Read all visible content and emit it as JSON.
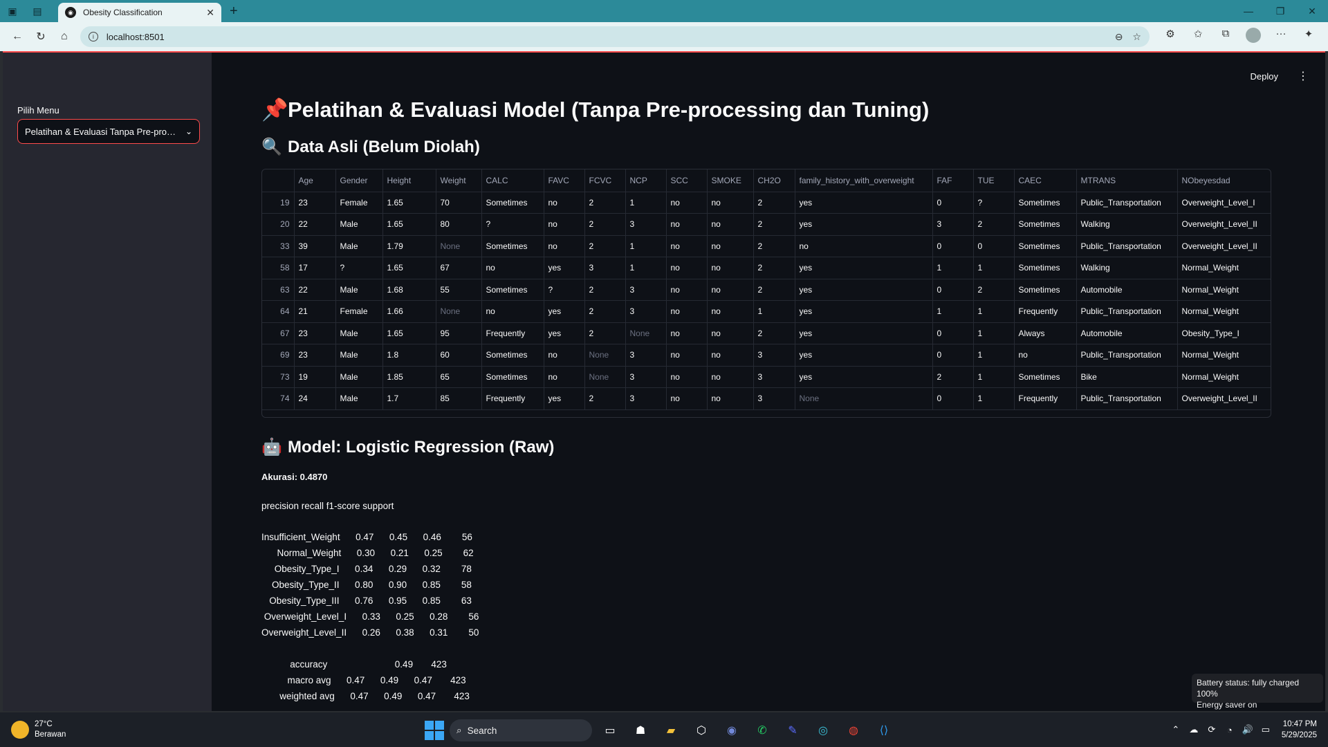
{
  "browser": {
    "tab_title": "Obesity Classification",
    "url": "localhost:8501"
  },
  "app": {
    "deploy_label": "Deploy",
    "sidebar": {
      "label": "Pilih Menu",
      "selected": "Pelatihan & Evaluasi Tanpa Pre-processing"
    },
    "title": "Pelatihan & Evaluasi Model (Tanpa Pre-processing dan Tuning)",
    "title_emoji": "📌",
    "section1": {
      "emoji": "🔍",
      "title": "Data Asli (Belum Diolah)"
    },
    "table": {
      "columns": [
        "",
        "Age",
        "Gender",
        "Height",
        "Weight",
        "CALC",
        "FAVC",
        "FCVC",
        "NCP",
        "SCC",
        "SMOKE",
        "CH2O",
        "family_history_with_overweight",
        "FAF",
        "TUE",
        "CAEC",
        "MTRANS",
        "NObeyesdad"
      ],
      "rows": [
        [
          "19",
          "23",
          "Female",
          "1.65",
          "70",
          "Sometimes",
          "no",
          "2",
          "1",
          "no",
          "no",
          "2",
          "yes",
          "0",
          "?",
          "Sometimes",
          "Public_Transportation",
          "Overweight_Level_I"
        ],
        [
          "20",
          "22",
          "Male",
          "1.65",
          "80",
          "?",
          "no",
          "2",
          "3",
          "no",
          "no",
          "2",
          "yes",
          "3",
          "2",
          "Sometimes",
          "Walking",
          "Overweight_Level_II"
        ],
        [
          "33",
          "39",
          "Male",
          "1.79",
          "None",
          "Sometimes",
          "no",
          "2",
          "1",
          "no",
          "no",
          "2",
          "no",
          "0",
          "0",
          "Sometimes",
          "Public_Transportation",
          "Overweight_Level_II"
        ],
        [
          "58",
          "17",
          "?",
          "1.65",
          "67",
          "no",
          "yes",
          "3",
          "1",
          "no",
          "no",
          "2",
          "yes",
          "1",
          "1",
          "Sometimes",
          "Walking",
          "Normal_Weight"
        ],
        [
          "63",
          "22",
          "Male",
          "1.68",
          "55",
          "Sometimes",
          "?",
          "2",
          "3",
          "no",
          "no",
          "2",
          "yes",
          "0",
          "2",
          "Sometimes",
          "Automobile",
          "Normal_Weight"
        ],
        [
          "64",
          "21",
          "Female",
          "1.66",
          "None",
          "no",
          "yes",
          "2",
          "3",
          "no",
          "no",
          "1",
          "yes",
          "1",
          "1",
          "Frequently",
          "Public_Transportation",
          "Normal_Weight"
        ],
        [
          "67",
          "23",
          "Male",
          "1.65",
          "95",
          "Frequently",
          "yes",
          "2",
          "None",
          "no",
          "no",
          "2",
          "yes",
          "0",
          "1",
          "Always",
          "Automobile",
          "Obesity_Type_I"
        ],
        [
          "69",
          "23",
          "Male",
          "1.8",
          "60",
          "Sometimes",
          "no",
          "None",
          "3",
          "no",
          "no",
          "3",
          "yes",
          "0",
          "1",
          "no",
          "Public_Transportation",
          "Normal_Weight"
        ],
        [
          "73",
          "19",
          "Male",
          "1.85",
          "65",
          "Sometimes",
          "no",
          "None",
          "3",
          "no",
          "no",
          "3",
          "yes",
          "2",
          "1",
          "Sometimes",
          "Bike",
          "Normal_Weight"
        ],
        [
          "74",
          "24",
          "Male",
          "1.7",
          "85",
          "Frequently",
          "yes",
          "2",
          "3",
          "no",
          "no",
          "3",
          "None",
          "0",
          "1",
          "Frequently",
          "Public_Transportation",
          "Overweight_Level_II"
        ]
      ]
    },
    "section2": {
      "emoji": "🤖",
      "title": "Model: Logistic Regression (Raw)"
    },
    "accuracy_text": "Akurasi: 0.4870",
    "report": {
      "header": "precision    recall  f1-score   support",
      "rows": [
        "Insufficient_Weight      0.47      0.45      0.46        56",
        "      Normal_Weight      0.30      0.21      0.25        62",
        "     Obesity_Type_I      0.34      0.29      0.32        78",
        "    Obesity_Type_II      0.80      0.90      0.85        58",
        "   Obesity_Type_III      0.76      0.95      0.85        63",
        " Overweight_Level_I      0.33      0.25      0.28        56",
        "Overweight_Level_II      0.26      0.38      0.31        50"
      ],
      "summary": [
        "           accuracy                          0.49       423",
        "          macro avg      0.47      0.49      0.47       423",
        "       weighted avg      0.47      0.49      0.47       423"
      ]
    }
  },
  "toast": {
    "line1": "Battery status: fully charged 100%",
    "line2": "Energy saver on"
  },
  "taskbar": {
    "weather_temp": "27°C",
    "weather_desc": "Berawan",
    "search_placeholder": "Search",
    "time": "10:47 PM",
    "date": "5/29/2025"
  },
  "colors": {
    "accent": "#ff4b4b",
    "tabbar": "#2c8a99",
    "app_bg": "#0e1117",
    "sidebar_bg": "#262730"
  }
}
